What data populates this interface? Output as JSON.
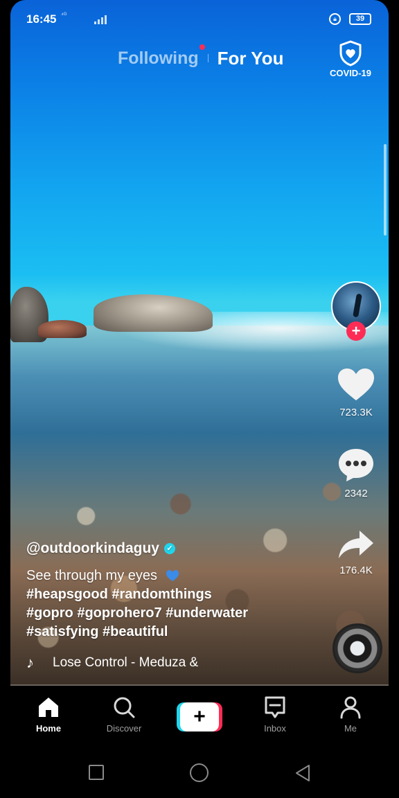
{
  "status_bar": {
    "time": "16:45",
    "network": "⁴ᴳ",
    "battery": "39"
  },
  "top_tabs": {
    "following": "Following",
    "for_you": "For You"
  },
  "covid": {
    "label": "COVID-19"
  },
  "rail": {
    "likes": "723.3K",
    "comments": "2342",
    "shares": "176.4K"
  },
  "caption": {
    "username": "@outdoorkindaguy",
    "description": "See through my eyes",
    "hashtags_line1": "#heapsgood #randomthings",
    "hashtags_line2": "#gopro #goprohero7 #underwater",
    "hashtags_line3": "#satisfying #beautiful"
  },
  "music": {
    "title": "Lose Control - Meduza &"
  },
  "bottom_nav": {
    "home": "Home",
    "discover": "Discover",
    "inbox": "Inbox",
    "me": "Me"
  },
  "colors": {
    "accent_red": "#fe2c55",
    "accent_cyan": "#20d5ec",
    "verified": "#20d5ec"
  }
}
